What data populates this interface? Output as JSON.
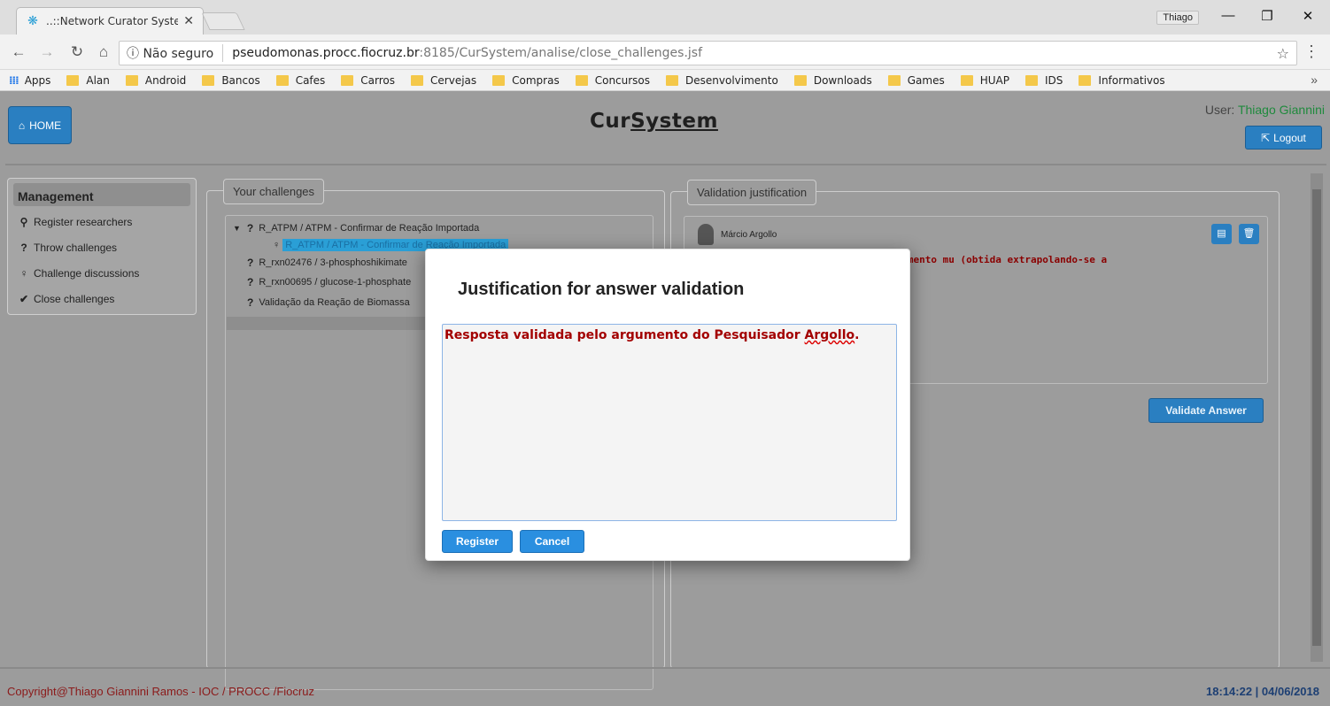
{
  "browser": {
    "tab_title": "..::Network Curator Syster",
    "window_user": "Thiago",
    "security_label": "ⓘ Não seguro",
    "url_host": "pseudomonas.procc.fiocruz.br",
    "url_rest": ":8185/CurSystem/analise/close_challenges.jsf",
    "bookmarks": [
      "Apps",
      "Alan",
      "Android",
      "Bancos",
      "Cafes",
      "Carros",
      "Cervejas",
      "Compras",
      "Concursos",
      "Desenvolvimento",
      "Downloads",
      "Games",
      "HUAP",
      "IDS",
      "Informativos"
    ]
  },
  "header": {
    "home_label": "HOME",
    "logo_left": "Cur",
    "logo_right": "System",
    "user_prefix": "User: ",
    "user_name": "Thiago Giannini",
    "logout_label": "Logout"
  },
  "sidebar": {
    "title": "Management",
    "items": [
      {
        "label": "Register researchers",
        "icon": "user-icon"
      },
      {
        "label": "Throw challenges",
        "icon": "question-icon"
      },
      {
        "label": "Challenge discussions",
        "icon": "lightbulb-icon"
      },
      {
        "label": "Close challenges",
        "icon": "check-icon"
      }
    ]
  },
  "challenges": {
    "legend": "Your challenges",
    "rows": [
      "R_ATPM / ATPM - Confirmar de Reação Importada",
      "R_ATPM / ATPM - Confirmar de Reação Importada",
      "R_rxn02476 / 3-phosphoshikimate",
      "R_rxn00695 / glucose-1-phosphate",
      "Validação da Reação de Biomassa"
    ]
  },
  "justification": {
    "legend": "Validation justification",
    "author": "Márcio Argollo",
    "text": "a independente da taxa de crescimento mu (obtida extrapolando-se a",
    "validate_label": "Validate Answer"
  },
  "modal": {
    "title": "Justification for answer validation",
    "text_main": "Resposta validada pelo argumento do Pesquisador ",
    "text_flagged": "Argollo",
    "text_end": ".",
    "register_label": "Register",
    "cancel_label": "Cancel"
  },
  "footer": {
    "copyright": "Copyright@Thiago Giannini Ramos - IOC / PROCC /Fiocruz",
    "clock": "18:14:22 | 04/06/2018"
  }
}
